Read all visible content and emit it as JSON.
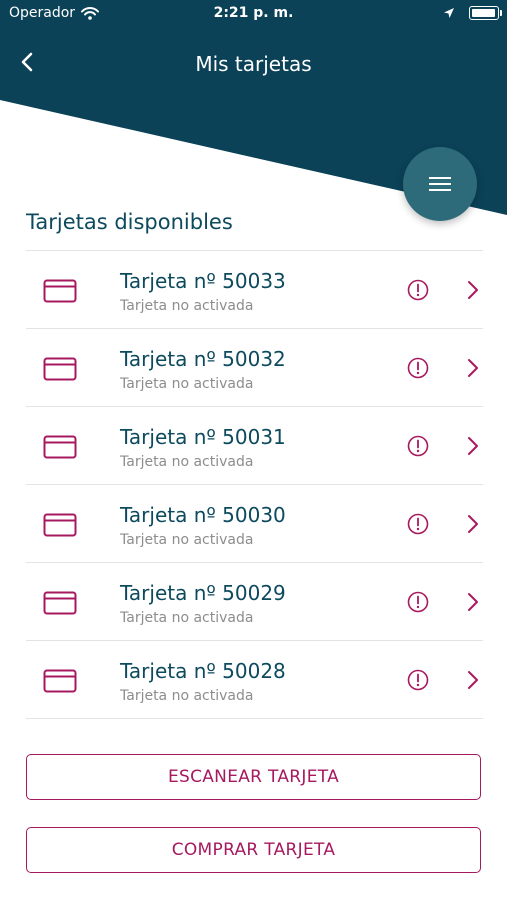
{
  "status_bar": {
    "carrier": "Operador",
    "time": "2:21 p. m."
  },
  "nav": {
    "title": "Mis tarjetas"
  },
  "section": {
    "title": "Tarjetas disponibles"
  },
  "cards": [
    {
      "name": "Tarjeta nº 50033",
      "status": "Tarjeta no activada"
    },
    {
      "name": "Tarjeta nº 50032",
      "status": "Tarjeta no activada"
    },
    {
      "name": "Tarjeta nº 50031",
      "status": "Tarjeta no activada"
    },
    {
      "name": "Tarjeta nº 50030",
      "status": "Tarjeta no activada"
    },
    {
      "name": "Tarjeta nº 50029",
      "status": "Tarjeta no activada"
    },
    {
      "name": "Tarjeta nº 50028",
      "status": "Tarjeta no activada"
    }
  ],
  "actions": {
    "scan_label": "ESCANEAR TARJETA",
    "buy_label": "COMPRAR TARJETA"
  },
  "icons": {
    "back": "chevron-left-icon",
    "menu": "hamburger-menu-icon",
    "card": "credit-card-icon",
    "alert": "exclamation-circle-icon",
    "chevron": "chevron-right-icon"
  },
  "colors": {
    "header": "#0b4258",
    "fab": "#2d6b7b",
    "accent": "#a6195f",
    "title_text": "#0d4a5e",
    "muted_text": "#8d8d8d"
  }
}
